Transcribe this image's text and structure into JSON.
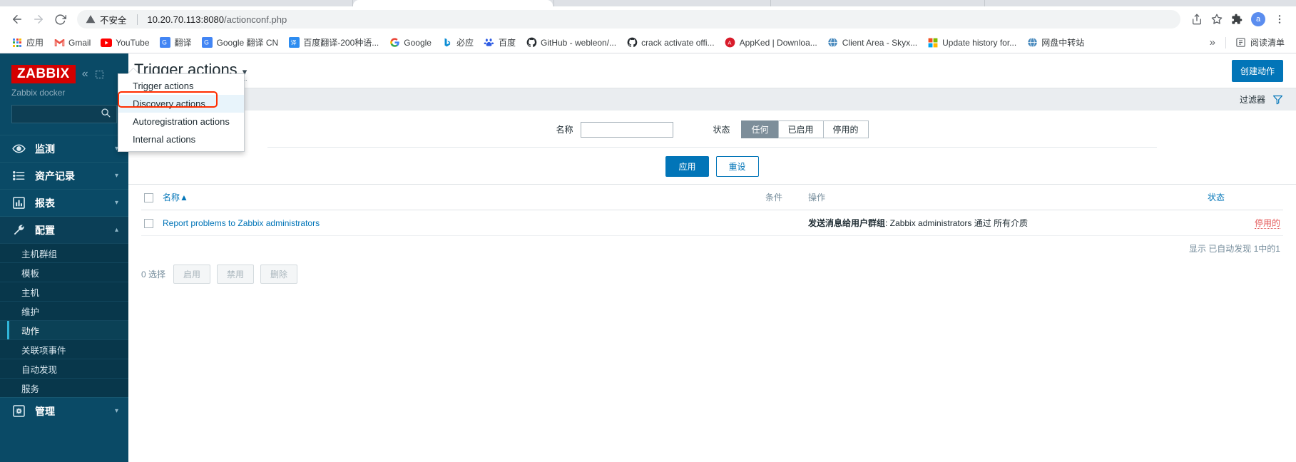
{
  "browser": {
    "nav": {
      "back": "back-arrow",
      "forward": "forward-arrow",
      "reload": "reload"
    },
    "omnibox": {
      "security_label": "不安全",
      "url_host": "10.20.70.113:8080",
      "url_path": "/actionconf.php",
      "share_icon": "share-icon",
      "bookmark_icon": "star-icon",
      "extensions_icon": "puzzle-icon",
      "avatar_initial": "a",
      "menu_icon": "kebab-menu-icon"
    },
    "bookmarks": [
      {
        "label": "应用",
        "icon": "apps-grid-icon"
      },
      {
        "label": "Gmail",
        "icon": "gmail-icon"
      },
      {
        "label": "YouTube",
        "icon": "youtube-icon"
      },
      {
        "label": "翻译",
        "icon": "google-translate-icon"
      },
      {
        "label": "Google 翻译 CN",
        "icon": "google-translate-icon"
      },
      {
        "label": "百度翻译-200种语...",
        "icon": "baidu-translate-icon"
      },
      {
        "label": "Google",
        "icon": "google-icon"
      },
      {
        "label": "必应",
        "icon": "bing-icon"
      },
      {
        "label": "百度",
        "icon": "baidu-icon"
      },
      {
        "label": "GitHub - webleon/...",
        "icon": "github-icon"
      },
      {
        "label": "crack activate offi...",
        "icon": "github-icon"
      },
      {
        "label": "AppKed | Downloa...",
        "icon": "appked-icon"
      },
      {
        "label": "Client Area - Skyx...",
        "icon": "globe-icon"
      },
      {
        "label": "Update history for...",
        "icon": "microsoft-icon"
      },
      {
        "label": "网盘中转站",
        "icon": "globe-icon"
      }
    ],
    "bookmarks_overflow": "»",
    "reading_list": {
      "label": "阅读清单",
      "icon": "reading-list-icon"
    }
  },
  "sidebar": {
    "logo": "ZABBIX",
    "collapse_icon": "chevron-double-left-icon",
    "compact_icon": "collapse-panel-icon",
    "server_name": "Zabbix docker",
    "search": {
      "value": "",
      "placeholder": "",
      "icon": "search-icon"
    },
    "groups": [
      {
        "label": "监测",
        "icon": "eye-icon",
        "caret": "chevron-down-icon",
        "expanded": false
      },
      {
        "label": "资产记录",
        "icon": "list-icon",
        "caret": "chevron-down-icon",
        "expanded": false
      },
      {
        "label": "报表",
        "icon": "bar-chart-icon",
        "caret": "chevron-down-icon",
        "expanded": false
      },
      {
        "label": "配置",
        "icon": "wrench-icon",
        "caret": "chevron-up-icon",
        "expanded": true
      }
    ],
    "config_items": [
      {
        "label": "主机群组",
        "active": false
      },
      {
        "label": "模板",
        "active": false
      },
      {
        "label": "主机",
        "active": false
      },
      {
        "label": "维护",
        "active": false
      },
      {
        "label": "动作",
        "active": true
      },
      {
        "label": "关联项事件",
        "active": false
      },
      {
        "label": "自动发现",
        "active": false
      },
      {
        "label": "服务",
        "active": false
      }
    ],
    "admin_group": {
      "label": "管理",
      "icon": "gear-icon",
      "caret": "chevron-down-icon"
    }
  },
  "header": {
    "title": "Trigger actions",
    "title_caret": "chevron-down-icon",
    "create_button": "创建动作"
  },
  "dropdown": {
    "open": true,
    "items": [
      {
        "label": "Trigger actions",
        "highlighted": false
      },
      {
        "label": "Discovery actions",
        "highlighted": true
      },
      {
        "label": "Autoregistration actions",
        "highlighted": false
      },
      {
        "label": "Internal actions",
        "highlighted": false
      }
    ],
    "annotation_color": "#ff2d00"
  },
  "filter": {
    "tab_label": "过滤器",
    "funnel_icon": "filter-funnel-icon",
    "name_label": "名称",
    "name_value": "",
    "status_label": "状态",
    "status_options": [
      {
        "label": "任何",
        "selected": true
      },
      {
        "label": "已启用",
        "selected": false
      },
      {
        "label": "停用的",
        "selected": false
      }
    ],
    "apply_button": "应用",
    "reset_button": "重设"
  },
  "table": {
    "columns": [
      {
        "label": "名称",
        "sort": "▲",
        "link": true
      },
      {
        "label": "条件",
        "sort": "",
        "link": false
      },
      {
        "label": "操作",
        "sort": "",
        "link": false
      },
      {
        "label": "状态",
        "sort": "",
        "link": true
      }
    ],
    "rows": [
      {
        "name": "Report problems to Zabbix administrators",
        "conditions": "",
        "operations_bold": "发送消息给用户群组",
        "operations_rest": ": Zabbix administrators 通过 所有介质",
        "status": "停用的"
      }
    ],
    "footer": "显示 已自动发现 1中的1"
  },
  "action_bar": {
    "selected_count": "0 选择",
    "buttons": [
      {
        "label": "启用",
        "disabled": true
      },
      {
        "label": "禁用",
        "disabled": true
      },
      {
        "label": "删除",
        "disabled": true
      }
    ]
  },
  "colors": {
    "zabbix_red": "#d40000",
    "sidebar_bg": "#0a4a66",
    "accent_blue": "#0275b8",
    "status_red": "#e45959",
    "annotation_red": "#ff2d00"
  }
}
